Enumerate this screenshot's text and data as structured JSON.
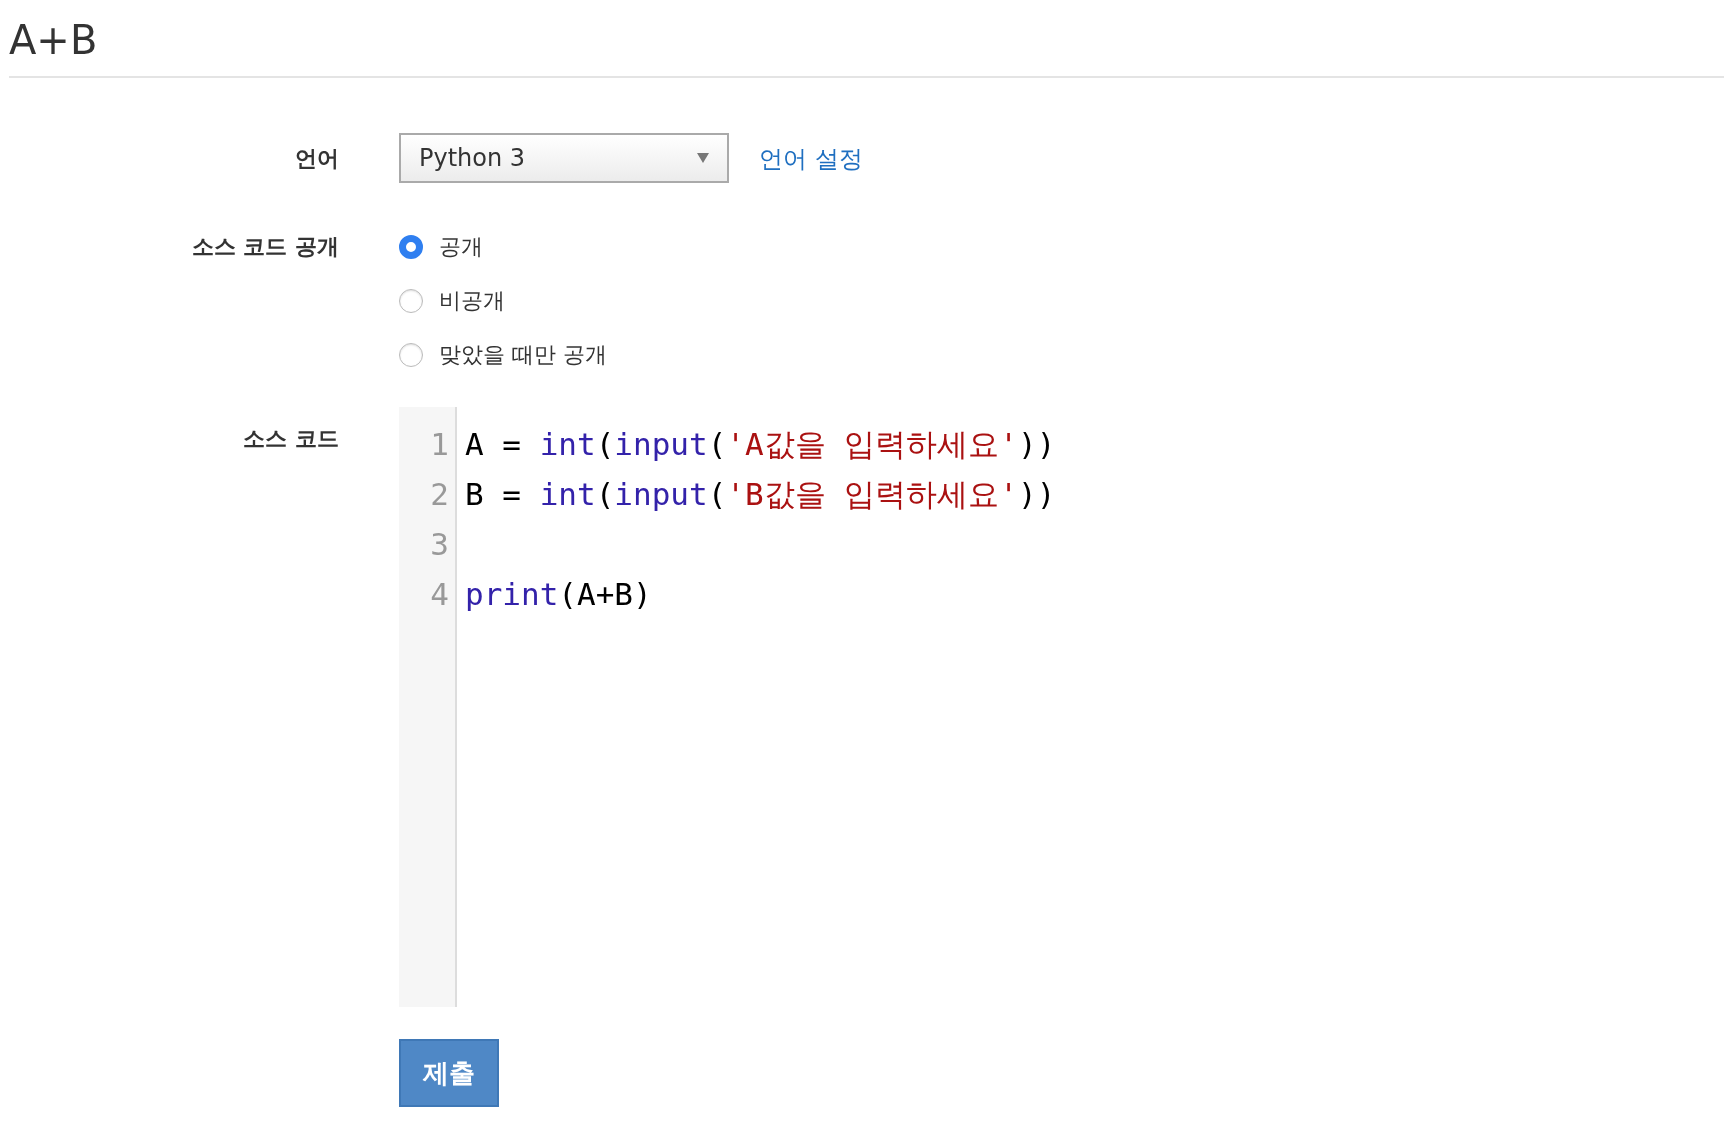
{
  "title": "A+B",
  "language": {
    "label": "언어",
    "value": "Python 3",
    "link": "언어 설정"
  },
  "visibility": {
    "label": "소스 코드 공개",
    "options": [
      {
        "label": "공개",
        "selected": true
      },
      {
        "label": "비공개",
        "selected": false
      },
      {
        "label": "맞았을 때만 공개",
        "selected": false
      }
    ]
  },
  "source": {
    "label": "소스 코드",
    "lines": [
      {
        "number": "1",
        "tokens": [
          {
            "kind": "plain",
            "text": "A = "
          },
          {
            "kind": "builtin",
            "text": "int"
          },
          {
            "kind": "plain",
            "text": "("
          },
          {
            "kind": "builtin",
            "text": "input"
          },
          {
            "kind": "plain",
            "text": "("
          },
          {
            "kind": "string",
            "text": "'A값을 입력하세요'"
          },
          {
            "kind": "plain",
            "text": "))"
          }
        ]
      },
      {
        "number": "2",
        "tokens": [
          {
            "kind": "plain",
            "text": "B = "
          },
          {
            "kind": "builtin",
            "text": "int"
          },
          {
            "kind": "plain",
            "text": "("
          },
          {
            "kind": "builtin",
            "text": "input"
          },
          {
            "kind": "plain",
            "text": "("
          },
          {
            "kind": "string",
            "text": "'B값을 입력하세요'"
          },
          {
            "kind": "plain",
            "text": "))"
          }
        ]
      },
      {
        "number": "3"
      },
      {
        "number": "4",
        "tokens": [
          {
            "kind": "builtin",
            "text": "print"
          },
          {
            "kind": "plain",
            "text": "(A+B)"
          }
        ]
      }
    ]
  },
  "submit": "제출"
}
